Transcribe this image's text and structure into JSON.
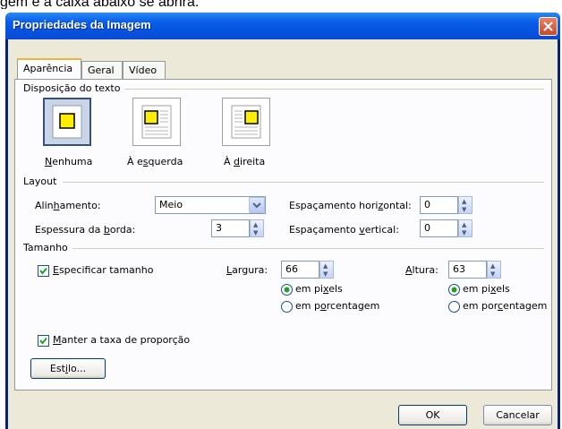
{
  "background_text": "gem e a caixa abaixo se abrirá.",
  "window": {
    "title": "Propriedades da Imagem",
    "close_glyph": "✕"
  },
  "tabs": [
    {
      "label": "Aparência"
    },
    {
      "label": "Geral"
    },
    {
      "label": "Vídeo"
    }
  ],
  "text_wrap": {
    "group_label": "Disposição do texto",
    "options": [
      {
        "prefix": "",
        "key": "N",
        "suffix": "enhuma",
        "selected": true
      },
      {
        "prefix": "À e",
        "key": "s",
        "suffix": "querda",
        "selected": false
      },
      {
        "prefix": "À ",
        "key": "d",
        "suffix": "ireita",
        "selected": false
      }
    ]
  },
  "layout": {
    "group_label": "Layout",
    "alignment": {
      "prefix": "Alin",
      "key": "h",
      "suffix": "amento:",
      "value": "Meio"
    },
    "border_thickness": {
      "prefix": "Espessura da ",
      "key": "b",
      "suffix": "orda:",
      "value": "3"
    },
    "horizontal_spacing": {
      "prefix": "Espaçamento hori",
      "key": "z",
      "suffix": "ontal:",
      "value": "0"
    },
    "vertical_spacing": {
      "prefix": "Espaçamento ",
      "key": "v",
      "suffix": "ertical:",
      "value": "0"
    }
  },
  "size": {
    "group_label": "Tamanho",
    "specify_size": {
      "key": "E",
      "suffix": "specificar tamanho",
      "checked": true
    },
    "width": {
      "key": "L",
      "suffix": "argura:",
      "value": "66",
      "pixels_prefix": "em pi",
      "pixels_key": "x",
      "pixels_suffix": "els",
      "percent_prefix": "em p",
      "percent_key": "o",
      "percent_suffix": "rcentagem"
    },
    "height": {
      "key": "A",
      "suffix": "ltura:",
      "value": "63",
      "pixels_prefix": "em pi",
      "pixels_key": "x",
      "pixels_suffix": "els",
      "percent_prefix": "em por",
      "percent_key": "c",
      "percent_suffix": "entagem"
    },
    "keep_ratio": {
      "key": "M",
      "suffix": "anter a taxa de proporção",
      "checked": true
    }
  },
  "style_button": {
    "prefix": "Est",
    "key": "i",
    "suffix": "lo..."
  },
  "buttons": {
    "ok": "OK",
    "cancel": "Cancelar"
  },
  "colors": {
    "title_bar": "#0a5de8",
    "dialog_bg": "#ece9d8",
    "selected_tab_accent": "#f4b43c",
    "image_placeholder": "#ffee00"
  }
}
